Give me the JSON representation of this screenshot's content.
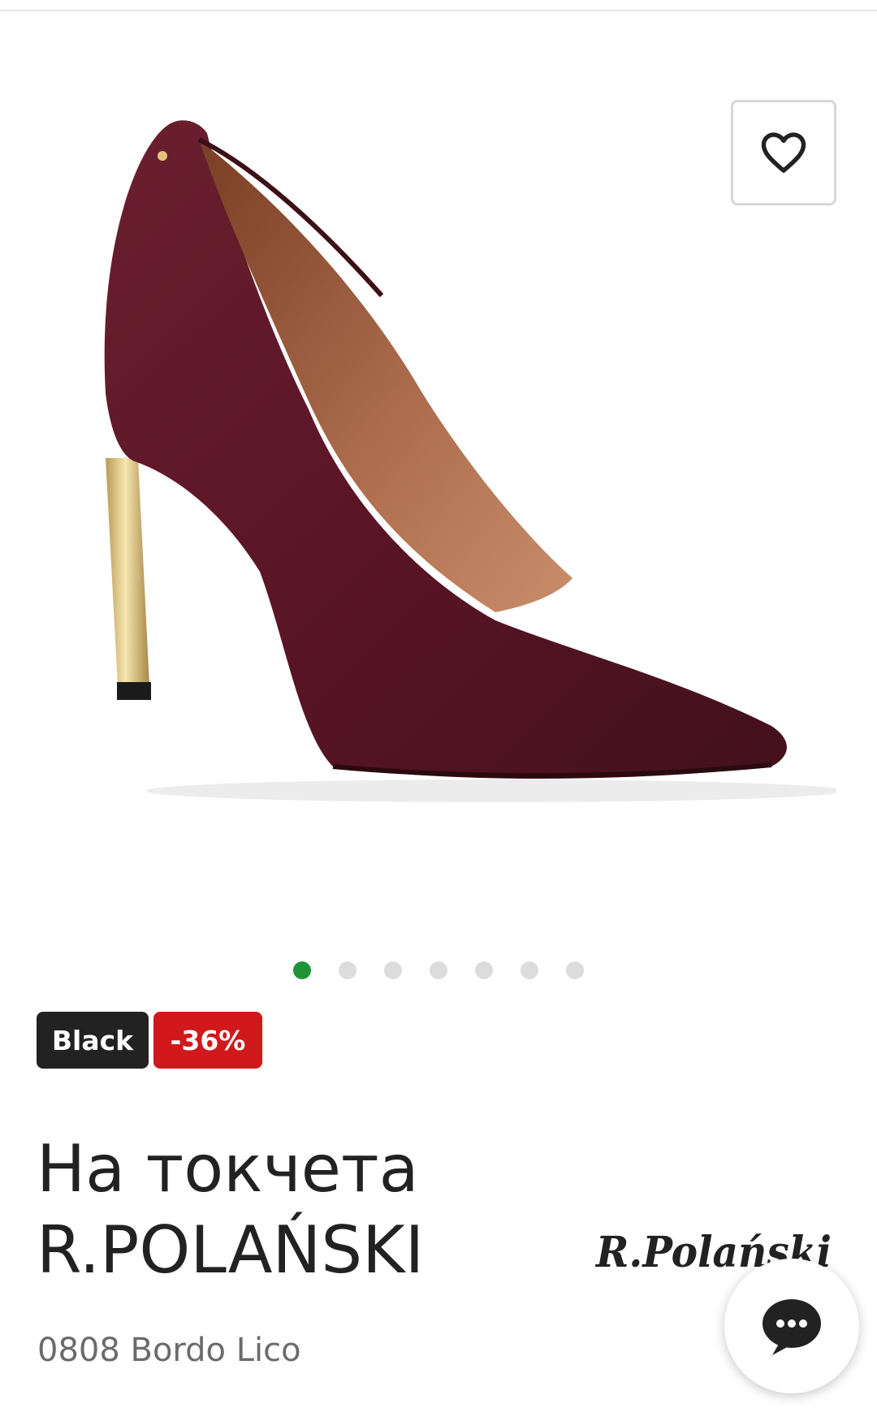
{
  "gallery": {
    "image_alt": "product-photo",
    "image_count": 7,
    "active_index": 0,
    "favorite_icon": "heart-icon",
    "colors": {
      "active_dot": "#1f9436",
      "inactive_dot": "#dcdcdc"
    }
  },
  "badges": {
    "tag": "Black",
    "discount": "-36%",
    "colors": {
      "tag_bg": "#222222",
      "discount_bg": "#d1191b"
    }
  },
  "product": {
    "title_line1": "На токчета",
    "title_line2": "R.POLAŃSKI",
    "variant": "0808 Bordo Lico",
    "brand_logo_text": "R.Polański"
  },
  "chat": {
    "icon": "chat-bubble-icon"
  }
}
